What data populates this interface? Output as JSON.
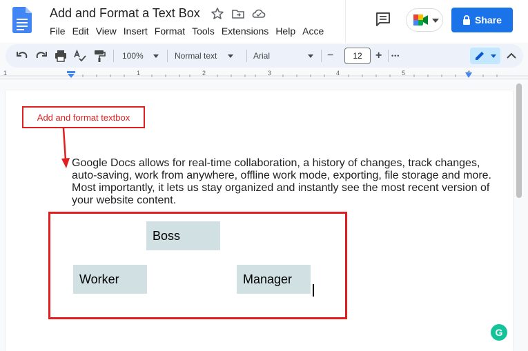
{
  "document": {
    "title": "Add and Format a Text Box"
  },
  "menu": {
    "items": [
      "File",
      "Edit",
      "View",
      "Insert",
      "Format",
      "Tools",
      "Extensions",
      "Help",
      "Acce"
    ]
  },
  "header": {
    "share_label": "Share"
  },
  "toolbar": {
    "zoom": "100%",
    "style": "Normal text",
    "font": "Arial",
    "font_size": "12",
    "minus": "−",
    "plus": "+",
    "more": "•••"
  },
  "ruler": {
    "numbers": [
      "1",
      "1",
      "2",
      "3",
      "4",
      "5",
      "6"
    ]
  },
  "annotation": {
    "label": "Add and format textbox",
    "color": "#e02020"
  },
  "content": {
    "paragraph": "Google Docs allows for real-time collaboration, a history of changes, track changes, auto-saving, work from anywhere, offline work mode, exporting, file storage and more. Most importantly, it lets us stay organized and instantly see the most recent version of your website content."
  },
  "textboxes": {
    "boss": "Boss",
    "worker": "Worker",
    "manager": "Manager",
    "fill_color": "#d0e0e3"
  },
  "colors": {
    "accent": "#1a73e8",
    "toolbar_bg": "#edf2fa"
  },
  "grammarly": {
    "letter": "G"
  }
}
